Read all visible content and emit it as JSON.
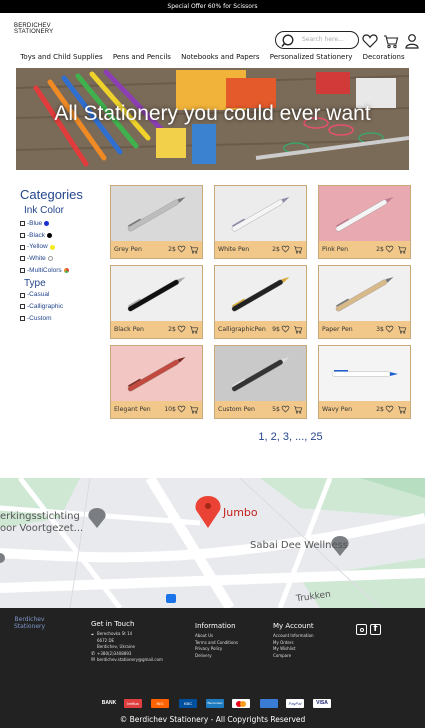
{
  "promo": "Special Offer 60% for Scissors",
  "logo": {
    "line1": "BERDICHEV",
    "line2": "STATIONERY"
  },
  "search": {
    "placeholder": "Search here..."
  },
  "nav": [
    "Toys and Child Supplies",
    "Pens and Pencils",
    "Notebooks and Papers",
    "Personalized Stationery",
    "Decorations"
  ],
  "hero": {
    "title": "All Stationery you could ever want"
  },
  "sidebar": {
    "categories_title": "Categories",
    "ink_title": "Ink Color",
    "ink_options": [
      {
        "label": "-Blue",
        "color": "#1a2fd1"
      },
      {
        "label": "-Black",
        "color": "#000000"
      },
      {
        "label": "-Yellow",
        "color": "#f5ec1f"
      },
      {
        "label": "-White",
        "color": "#ffffff"
      },
      {
        "label": "-MultiColors",
        "color": "multi"
      }
    ],
    "type_title": "Type",
    "type_options": [
      "-Casual",
      "-Calligraphic",
      "-Custom"
    ]
  },
  "products": [
    {
      "name": "Grey Pen",
      "price": "2$"
    },
    {
      "name": "White Pen",
      "price": "2$"
    },
    {
      "name": "Pink Pen",
      "price": "2$"
    },
    {
      "name": "Black Pen",
      "price": "2$"
    },
    {
      "name": "CalligraphicPen",
      "price": "9$"
    },
    {
      "name": "Paper Pen",
      "price": "3$"
    },
    {
      "name": "Elegant Pen",
      "price": "10$"
    },
    {
      "name": "Custom Pen",
      "price": "5$"
    },
    {
      "name": "Wavy Pen",
      "price": "2$"
    }
  ],
  "pagination": "1, 2, 3, ..., 25",
  "map": {
    "place1": "Jumbo",
    "place2": "Sabai Dee Wellness",
    "place3": "erkingsstichting",
    "place4": "oor Voortgezet...",
    "street": "Trukken"
  },
  "footer": {
    "brand_line1": "Berdichev",
    "brand_line2": "Stationery",
    "contact_title": "Get in Touch",
    "address_lines": [
      "Berechovka St 14",
      "6672 DE",
      "Berdichev, Ukraine"
    ],
    "phone": "+380(2)3408893",
    "email": "berdichev.stationery@gmail.com",
    "info_title": "Information",
    "info_links": [
      "About Us",
      "Terms and Conditions",
      "Privacy Policy",
      "Delivery"
    ],
    "account_title": "My Account",
    "account_links": [
      "Account Information",
      "My Orders",
      "My Wishlist",
      "Compare"
    ],
    "payments": [
      "BANK",
      "belfius",
      "ING",
      "KBC",
      "Bancontact",
      "mastercard",
      "",
      "PayPal",
      "VISA"
    ],
    "copyright": "©  Berdichev Stationery - All Copyrights Reserved"
  }
}
